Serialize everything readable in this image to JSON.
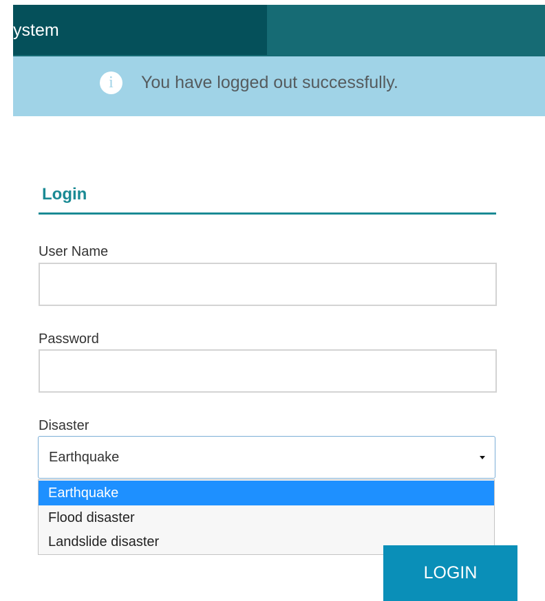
{
  "header": {
    "title": "ystem"
  },
  "alert": {
    "icon": "info-icon",
    "icon_glyph": "i",
    "message": "You have logged out successfully."
  },
  "login": {
    "heading": "Login",
    "username": {
      "label": "User Name",
      "value": "",
      "placeholder": ""
    },
    "password": {
      "label": "Password",
      "value": "",
      "placeholder": ""
    },
    "disaster": {
      "label": "Disaster",
      "selected": "Earthquake",
      "options": [
        "Earthquake",
        "Flood disaster",
        "Landslide disaster"
      ],
      "highlighted_index": 0
    },
    "submit_label": "LOGIN"
  },
  "colors": {
    "header_bg": "#166b74",
    "header_title_bg": "#05505a",
    "alert_bg": "#a0d3e7",
    "accent": "#1a8a94",
    "option_highlight": "#1e90ff",
    "button_bg": "#0a8fb8"
  }
}
